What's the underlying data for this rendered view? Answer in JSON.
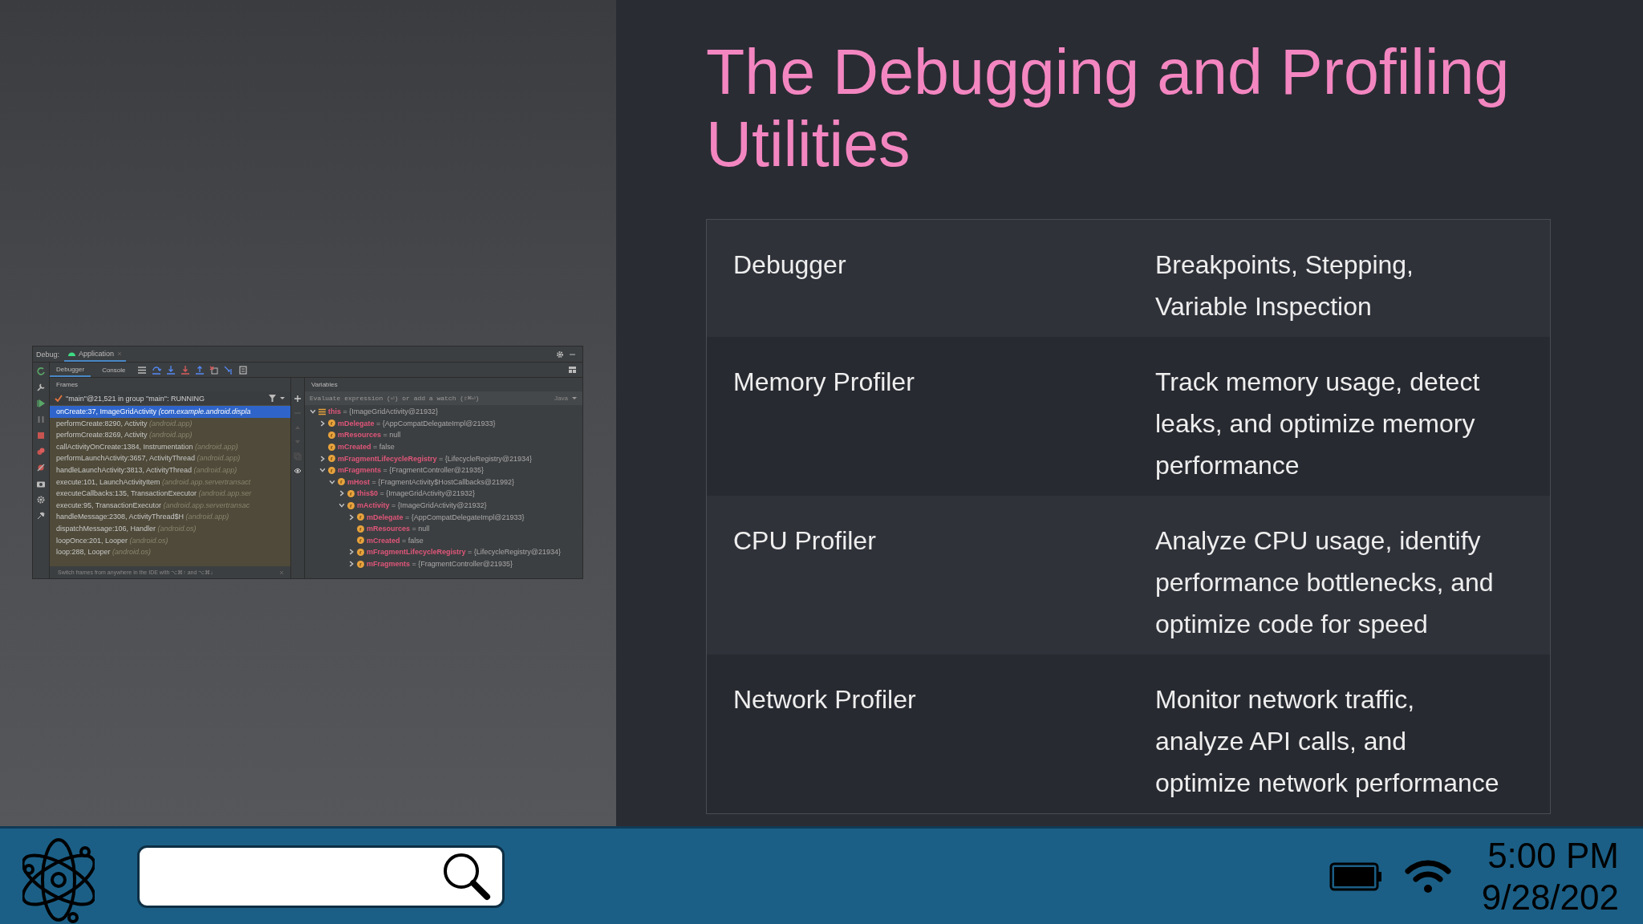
{
  "debugger": {
    "label": "Debug:",
    "tabs": [
      {
        "label": "Application",
        "selected": true
      }
    ],
    "subtabs": [
      {
        "label": "Debugger",
        "selected": true
      },
      {
        "label": "Console",
        "selected": false
      }
    ],
    "frames_header": "Frames",
    "variables_header": "Variables",
    "thread": "\"main\"@21,521 in group \"main\": RUNNING",
    "frames": [
      {
        "method": "onCreate:37, ImageGridActivity",
        "package": "(com.example.android.displa",
        "selected": true
      },
      {
        "method": "performCreate:8290, Activity",
        "package": "(android.app)",
        "selected": false
      },
      {
        "method": "performCreate:8269, Activity",
        "package": "(android.app)",
        "selected": false
      },
      {
        "method": "callActivityOnCreate:1384, Instrumentation",
        "package": "(android.app)",
        "selected": false
      },
      {
        "method": "performLaunchActivity:3657, ActivityThread",
        "package": "(android.app)",
        "selected": false
      },
      {
        "method": "handleLaunchActivity:3813, ActivityThread",
        "package": "(android.app)",
        "selected": false
      },
      {
        "method": "execute:101, LaunchActivityItem",
        "package": "(android.app.servertransact",
        "selected": false
      },
      {
        "method": "executeCallbacks:135, TransactionExecutor",
        "package": "(android.app.ser",
        "selected": false
      },
      {
        "method": "execute:95, TransactionExecutor",
        "package": "(android.app.servertransac",
        "selected": false
      },
      {
        "method": "handleMessage:2308, ActivityThread$H",
        "package": "(android.app)",
        "selected": false
      },
      {
        "method": "dispatchMessage:106, Handler",
        "package": "(android.os)",
        "selected": false
      },
      {
        "method": "loopOnce:201, Looper",
        "package": "(android.os)",
        "selected": false
      },
      {
        "method": "loop:288, Looper",
        "package": "(android.os)",
        "selected": false
      }
    ],
    "hint": "Switch frames from anywhere in the IDE with ⌥⌘↑ and ⌥⌘↓",
    "watch_placeholder": "Evaluate expression (⏎) or add a watch (⇧⌘⏎)",
    "language": "Java",
    "variables": [
      {
        "kind": "object",
        "name": "this",
        "value": "= {ImageGridActivity@21932}",
        "expandable": true,
        "expanded": true,
        "children": [
          {
            "kind": "field",
            "name": "mDelegate",
            "value": "= {AppCompatDelegateImpl@21933}",
            "expandable": true,
            "expanded": false
          },
          {
            "kind": "field",
            "name": "mResources",
            "value": "= null",
            "expandable": false
          },
          {
            "kind": "field",
            "name": "mCreated",
            "value": "= false",
            "expandable": false
          },
          {
            "kind": "field",
            "name": "mFragmentLifecycleRegistry",
            "value": "= {LifecycleRegistry@21934}",
            "expandable": true,
            "expanded": false
          },
          {
            "kind": "field",
            "name": "mFragments",
            "value": "= {FragmentController@21935}",
            "expandable": true,
            "expanded": true,
            "children": [
              {
                "kind": "field",
                "name": "mHost",
                "value": "= {FragmentActivity$HostCallbacks@21992}",
                "expandable": true,
                "expanded": true,
                "children": [
                  {
                    "kind": "field",
                    "name": "this$0",
                    "value": "= {ImageGridActivity@21932}",
                    "expandable": true,
                    "expanded": false
                  },
                  {
                    "kind": "field",
                    "name": "mActivity",
                    "value": "= {ImageGridActivity@21932}",
                    "expandable": true,
                    "expanded": true,
                    "children": [
                      {
                        "kind": "field",
                        "name": "mDelegate",
                        "value": "= {AppCompatDelegateImpl@21933}",
                        "expandable": true,
                        "expanded": false
                      },
                      {
                        "kind": "field",
                        "name": "mResources",
                        "value": "= null",
                        "expandable": false
                      },
                      {
                        "kind": "field",
                        "name": "mCreated",
                        "value": "= false",
                        "expandable": false
                      },
                      {
                        "kind": "field",
                        "name": "mFragmentLifecycleRegistry",
                        "value": "= {LifecycleRegistry@21934}",
                        "expandable": true,
                        "expanded": false
                      },
                      {
                        "kind": "field",
                        "name": "mFragments",
                        "value": "= {FragmentController@21935}",
                        "expandable": true,
                        "expanded": false
                      }
                    ]
                  }
                ]
              }
            ]
          }
        ]
      }
    ]
  },
  "slide": {
    "title": "The Debugging and Profiling Utilities",
    "rows": [
      {
        "tool": "Debugger",
        "description": "Breakpoints, Stepping, Variable Inspection"
      },
      {
        "tool": "Memory Profiler",
        "description": "Track memory usage, detect leaks, and optimize memory performance"
      },
      {
        "tool": "CPU Profiler",
        "description": "Analyze CPU usage, identify performance bottlenecks, and optimize code for speed"
      },
      {
        "tool": "Network Profiler",
        "description": "Monitor network traffic, analyze API calls, and optimize network performance"
      }
    ]
  },
  "taskbar": {
    "time": "5:00 PM",
    "date": "9/28/202"
  }
}
